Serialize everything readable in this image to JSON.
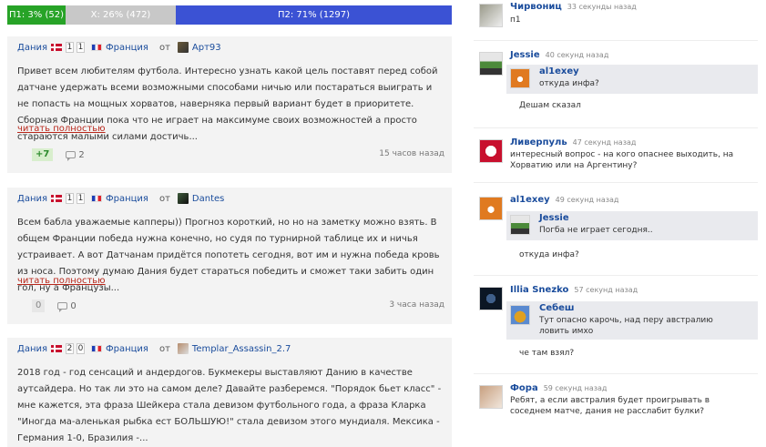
{
  "vote_bar": {
    "p1": "П1: 3% (52)",
    "x": "X: 26% (472)",
    "p2": "П2: 71% (1297)"
  },
  "posts": [
    {
      "team_a": "Дания",
      "score_a": "1",
      "score_b": "1",
      "team_b": "Франция",
      "ot": "от",
      "author": "Арт93",
      "body": "Привет всем любителям футбола. Интересно узнать какой цель поставят перед собой датчане удержать всеми возможными способами ничью или постараться выиграть и не попасть на мощных хорватов, наверняка первый вариант будет в приоритете. Сборная Франции пока что не играет на максимуме своих возможностей а просто стараются малыми силами достичь...",
      "read_more": "читать полностью",
      "rating": "+7",
      "comments": "2",
      "time": "15 часов назад"
    },
    {
      "team_a": "Дания",
      "score_a": "1",
      "score_b": "1",
      "team_b": "Франция",
      "ot": "от",
      "author": "Dantes",
      "body": "Всем бабла уважаемые капперы)) Прогноз короткий, но но на заметку можно взять. В общем Франции победа нужна конечно, но судя по турнирной таблице их и ничья устраивает. А вот Датчанам придётся попотеть сегодня, вот им и нужна победа кровь из носа. Поэтому думаю Дания будет стараться победить и сможет таки забить один гол, ну а Французы...",
      "read_more": "читать полностью",
      "rating": "0",
      "comments": "0",
      "time": "3 часа назад"
    },
    {
      "team_a": "Дания",
      "score_a": "2",
      "score_b": "0",
      "team_b": "Франция",
      "ot": "от",
      "author": "Templar_Assassin_2.7",
      "body": "2018 год - год сенсаций и андердогов. Букмекеры выставляют Данию в качестве аутсайдера. Но так ли это на самом деле? Давайте разберемся. \"Порядок бьет класс\" - мне кажется, эта фраза Шейкера стала девизом футбольного года, а фраза Кларка \"Иногда ма-аленькая рыбка ест БОЛЬШУЮ!\" стала девизом этого мундиаля. Мексика - Германия 1-0, Бразилия -..."
    }
  ],
  "chat": [
    {
      "name": "Чирвониц",
      "time": "33 секунды назад",
      "text": "п1"
    },
    {
      "name": "Jessie",
      "time": "40 секунд назад",
      "quote_name": "al1exey",
      "quote_text": "откуда инфа?",
      "reply": "Дешам сказал"
    },
    {
      "name": "Ливерпуль",
      "time": "47 секунд назад",
      "text": "интересный вопрос - на кого опаснее выходить, на Хорватию или на Аргентину?"
    },
    {
      "name": "al1exey",
      "time": "49 секунд назад",
      "quote_name": "Jessie",
      "quote_text": "Погба не играет сегодня..",
      "reply": "откуда инфа?"
    },
    {
      "name": "Illia Snezko",
      "time": "57 секунд назад",
      "quote_name": "Себеш",
      "quote_text": "Тут опасно карочь, над перу австралию\nловить имхо",
      "reply": "че там взял?"
    },
    {
      "name": "Фора",
      "time": "59 секунд назад",
      "text": "Ребят, а если австралия будет проигрывать в соседнем матче, дания не расслабит булки?"
    }
  ]
}
